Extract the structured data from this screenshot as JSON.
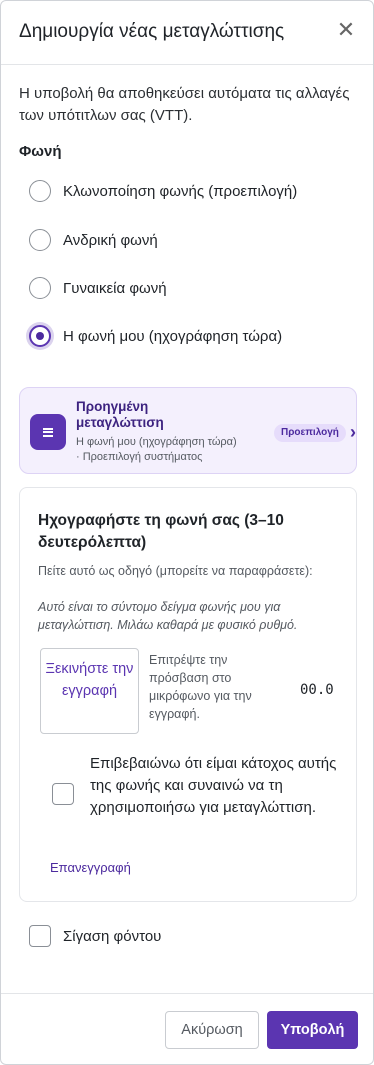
{
  "header": {
    "title": "Δημιουργία νέας μεταγλώττισης",
    "close_glyph": "✕"
  },
  "description": "Η υποβολή θα αποθηκεύσει αυτόματα τις αλλαγές των υπότιτλων σας (VTT).",
  "voice": {
    "label": "Φωνή",
    "options": [
      {
        "label": "Κλωνοποίηση φωνής (προεπιλογή)",
        "checked": false
      },
      {
        "label": "Ανδρική φωνή",
        "checked": false
      },
      {
        "label": "Γυναικεία φωνή",
        "checked": false
      },
      {
        "label": "Η φωνή μου (ηχογράφηση τώρα)",
        "checked": true
      }
    ]
  },
  "advanced": {
    "title": "Προηγμένη μεταγλώττιση",
    "subtitle_line1": "Η φωνή μου (ηχογράφηση τώρα)",
    "subtitle_line2": "· Προεπιλογή συστήματος",
    "badge": "Προεπιλογή",
    "icon": "menu-lines-icon",
    "chevron": "›"
  },
  "recording": {
    "heading": "Ηχογραφήστε τη φωνή σας (3–10 δευτερόλεπτα)",
    "instructions": "Πείτε αυτό ως οδηγό (μπορείτε να παραφράσετε):",
    "script": "Αυτό είναι το σύντομο δείγμα φωνής μου για μεταγλώττιση. Μιλάω καθαρά με φυσικό ρυθμό.",
    "start_button": "Ξεκινήστε την εγγραφή",
    "permission_note": "Επιτρέψτε την πρόσβαση στο μικρόφωνο για την εγγραφή.",
    "timer": "00.0",
    "consent": "Επιβεβαιώνω ότι είμαι κάτοχος αυτής της φωνής και συναινώ να τη χρησιμοποιήσω για μεταγλώττιση.",
    "rerecord": "Επανεγγραφή"
  },
  "background_mute": {
    "label": "Σίγαση φόντου",
    "checked": false
  },
  "footer": {
    "cancel": "Ακύρωση",
    "submit": "Υποβολή"
  },
  "colors": {
    "accent": "#5b35b1",
    "accent_light": "#f4f0fd",
    "badge_bg": "#e6dcfb"
  }
}
